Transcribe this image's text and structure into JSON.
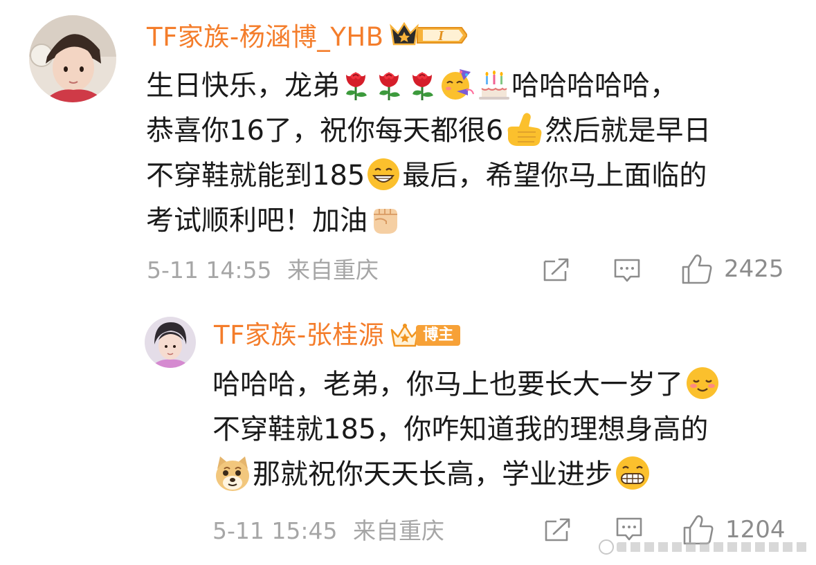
{
  "comment": {
    "username": "TF家族-杨涵博_YHB",
    "badge": "I",
    "lines": [
      [
        "生日快乐，龙弟",
        "emoji:rose",
        "emoji:rose",
        "emoji:rose",
        "emoji:party-face",
        "emoji:cake",
        "哈哈哈哈哈，"
      ],
      [
        "恭喜你16了，祝你每天都很6",
        "emoji:call-me-hand",
        "然后就是早日"
      ],
      [
        "不穿鞋就能到185",
        "emoji:grin",
        "最后，希望你马上面临的"
      ],
      [
        "考试顺利吧！加油",
        "emoji:fist"
      ]
    ],
    "timestamp": "5-11 14:55",
    "location": "来自重庆",
    "like_count": "2425"
  },
  "reply": {
    "username": "TF家族-张桂源",
    "badge_label": "博主",
    "lines": [
      [
        "哈哈哈，老弟，你马上也要长大一岁了",
        "emoji:smiling-blush"
      ],
      [
        "不穿鞋就185，你咋知道我的理想身高的"
      ],
      [
        "emoji:doge",
        "那就祝你天天长高，学业进步",
        "emoji:grimace"
      ]
    ],
    "timestamp": "5-11 15:45",
    "location": "来自重庆",
    "like_count": "1204"
  },
  "colors": {
    "username": "#f47d2b",
    "meta": "#a6a6a6",
    "text": "#1a1a1a",
    "badge_orange": "#f7a137"
  },
  "icons": [
    "share-icon",
    "comment-icon",
    "like-icon",
    "crown-badge-icon",
    "blogger-crown-icon"
  ]
}
